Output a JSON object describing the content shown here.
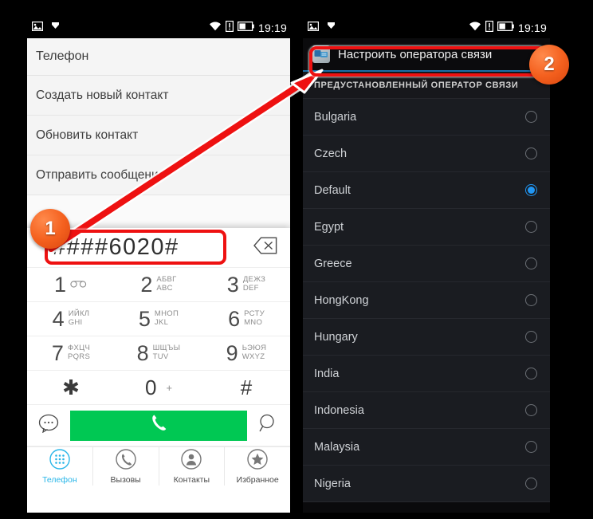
{
  "status_bar": {
    "icons_left": [
      "image-icon",
      "download-icon"
    ],
    "icons_right": [
      "wifi-icon",
      "alert-icon",
      "battery-icon"
    ],
    "time": "19:19"
  },
  "left_panel": {
    "app_title": "Телефон",
    "menu_items": [
      {
        "label": "Создать новый контакт"
      },
      {
        "label": "Обновить контакт"
      },
      {
        "label": "Отправить сообщение"
      }
    ],
    "dialer": {
      "number": "####6020#",
      "backspace_icon": "backspace-icon",
      "keys": [
        {
          "digit": "1",
          "ru": "",
          "en": "",
          "icon": "voicemail-icon"
        },
        {
          "digit": "2",
          "ru": "АБВГ",
          "en": "ABC",
          "icon": ""
        },
        {
          "digit": "3",
          "ru": "ДЕЖЗ",
          "en": "DEF",
          "icon": ""
        },
        {
          "digit": "4",
          "ru": "ИЙКЛ",
          "en": "GHI",
          "icon": ""
        },
        {
          "digit": "5",
          "ru": "МНОП",
          "en": "JKL",
          "icon": ""
        },
        {
          "digit": "6",
          "ru": "РСТУ",
          "en": "MNO",
          "icon": ""
        },
        {
          "digit": "7",
          "ru": "ФХЦЧ",
          "en": "PQRS",
          "icon": ""
        },
        {
          "digit": "8",
          "ru": "ШЩЪЫ",
          "en": "TUV",
          "icon": ""
        },
        {
          "digit": "9",
          "ru": "ЬЭЮЯ",
          "en": "WXYZ",
          "icon": ""
        }
      ],
      "star": "✱",
      "zero": "0",
      "zero_alt": "+",
      "hash": "#",
      "message_icon": "message-bubble-icon",
      "call_icon": "phone-handset-icon",
      "search_icon": "search-icon",
      "call_button_color": "#00C853"
    },
    "tabs": [
      {
        "label": "Телефон",
        "icon": "dialpad-icon",
        "active": true
      },
      {
        "label": "Вызовы",
        "icon": "phone-icon",
        "active": false
      },
      {
        "label": "Контакты",
        "icon": "person-icon",
        "active": false
      },
      {
        "label": "Избранное",
        "icon": "star-icon",
        "active": false
      }
    ],
    "active_tab_color": "#29b6e8"
  },
  "right_panel": {
    "header": {
      "title": "Настроить оператора связи",
      "icon": "carrier-settings-icon"
    },
    "section_label": "ПРЕДУСТАНОВЛЕННЫЙ ОПЕРАТОР СВЯЗИ",
    "operators": [
      {
        "name": "Bulgaria",
        "selected": false
      },
      {
        "name": "Czech",
        "selected": false
      },
      {
        "name": "Default",
        "selected": true
      },
      {
        "name": "Egypt",
        "selected": false
      },
      {
        "name": "Greece",
        "selected": false
      },
      {
        "name": "HongKong",
        "selected": false
      },
      {
        "name": "Hungary",
        "selected": false
      },
      {
        "name": "India",
        "selected": false
      },
      {
        "name": "Indonesia",
        "selected": false
      },
      {
        "name": "Malaysia",
        "selected": false
      },
      {
        "name": "Nigeria",
        "selected": false
      }
    ],
    "selected_color": "#2196f3"
  },
  "annotations": {
    "badge_1": "1",
    "badge_2": "2",
    "highlight_color": "#ee1111"
  }
}
